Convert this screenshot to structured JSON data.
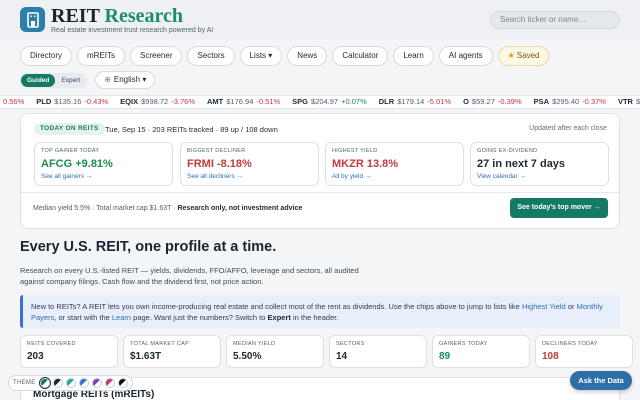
{
  "header": {
    "brand_part1": "REIT",
    "brand_part2": "Research",
    "tagline": "Real estate investment trust research powered by AI",
    "search_placeholder": "Search ticker or name…"
  },
  "nav": {
    "items": [
      "Directory",
      "mREITs",
      "Screener",
      "Sectors",
      "Lists ▾",
      "News",
      "Calculator",
      "Learn",
      "AI agents"
    ],
    "saved_label": "Saved"
  },
  "modes": {
    "guided": "Guided",
    "expert": "Expert",
    "language": "English",
    "language_chevron": "▾"
  },
  "ticker": [
    {
      "sym": "",
      "price": "",
      "chg": "0.56%",
      "dir": "neg"
    },
    {
      "sym": "PLD",
      "price": "$135.16",
      "chg": "-0.43%",
      "dir": "neg"
    },
    {
      "sym": "EQIX",
      "price": "$998.72",
      "chg": "-3.76%",
      "dir": "neg"
    },
    {
      "sym": "AMT",
      "price": "$176.94",
      "chg": "-0.51%",
      "dir": "neg"
    },
    {
      "sym": "SPG",
      "price": "$204.97",
      "chg": "+0.07%",
      "dir": "pos"
    },
    {
      "sym": "DLR",
      "price": "$179.14",
      "chg": "-5.01%",
      "dir": "neg"
    },
    {
      "sym": "O",
      "price": "$59.27",
      "chg": "-0.39%",
      "dir": "neg"
    },
    {
      "sym": "PSA",
      "price": "$295.40",
      "chg": "-0.37%",
      "dir": "neg"
    },
    {
      "sym": "VTR",
      "price": "$",
      "chg": "",
      "dir": "neg"
    }
  ],
  "today": {
    "badge": "TODAY ON REITS",
    "info": "Tue, Sep 15 · 203 REITs tracked · 89 up / 108 down",
    "updated": "Updated after each close",
    "cards": [
      {
        "label": "TOP GAINER TODAY",
        "value": "AFCG +9.81%",
        "link": "See all gainers →",
        "tone": "g"
      },
      {
        "label": "BIGGEST DECLINER",
        "value": "FRMI -8.18%",
        "link": "See all decliners →",
        "tone": "r"
      },
      {
        "label": "HIGHEST YIELD",
        "value": "MKZR 13.8%",
        "link": "All by yield →",
        "tone": "r"
      },
      {
        "label": "GOING EX-DIVIDEND",
        "value": "27 in next 7 days",
        "link": "View calendar →",
        "tone": "d"
      }
    ],
    "footer_text": "Median yield 5.5% · Total market cap $1.63T · ",
    "footer_bold": "Research only, not investment advice",
    "cta": "See today's top mover →"
  },
  "hero": {
    "title": "Every U.S. REIT, one profile at a time.",
    "lead": "Research on every U.S.-listed REIT — yields, dividends, FFO/AFFO, leverage and sectors, all audited against company filings. Cash flow and the dividend first, not price action."
  },
  "note": {
    "p1": "New to REITs? A REIT lets you own income-producing real estate and collect most of the rent as dividends. Use the chips above to jump to lists like ",
    "link1": "Highest Yield",
    "p2": " or ",
    "link2": "Monthly Payers",
    "p3": ", or start with the ",
    "link3": "Learn",
    "p4": " page. Want just the numbers? Switch to ",
    "bold": "Expert",
    "p5": " in the header."
  },
  "stats": [
    {
      "label": "REITS COVERED",
      "value": "203",
      "tone": ""
    },
    {
      "label": "TOTAL MARKET CAP",
      "value": "$1.63T",
      "tone": ""
    },
    {
      "label": "MEDIAN YIELD",
      "value": "5.50%",
      "tone": ""
    },
    {
      "label": "SECTORS",
      "value": "14",
      "tone": ""
    },
    {
      "label": "GAINERS TODAY",
      "value": "89",
      "tone": "g"
    },
    {
      "label": "DECLINERS TODAY",
      "value": "108",
      "tone": "r"
    }
  ],
  "section": {
    "title": "Mortgage REITs (mREITs)"
  },
  "theme": {
    "label": "THEME",
    "swatches": [
      "#157a64",
      "#1a2530",
      "#2aa3a3",
      "#3c6fd1",
      "#7a3fc0",
      "#c23b7a",
      "#111111"
    ]
  },
  "ask_button": "Ask the Data"
}
